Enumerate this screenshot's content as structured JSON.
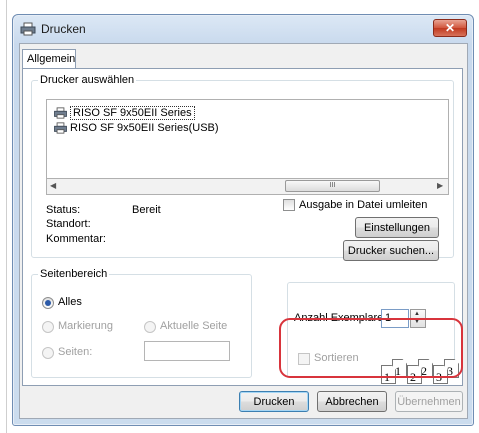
{
  "window": {
    "title": "Drucken",
    "close_glyph": "✕"
  },
  "tabs": [
    {
      "label": "Allgemein"
    }
  ],
  "printer_group": {
    "legend": "Drucker auswählen",
    "printers": [
      {
        "name": "RISO SF 9x50EII Series",
        "selected": true
      },
      {
        "name": "RISO SF 9x50EII Series(USB)",
        "selected": false
      }
    ],
    "scroll_thumb_glyph": "III",
    "status_label": "Status:",
    "status_value": "Bereit",
    "location_label": "Standort:",
    "comment_label": "Kommentar:",
    "print_to_file_label": "Ausgabe in Datei umleiten",
    "settings_button": "Einstellungen",
    "find_printer_button": "Drucker suchen..."
  },
  "page_range": {
    "legend": "Seitenbereich",
    "options": [
      {
        "label": "Alles",
        "checked": true,
        "disabled": false
      },
      {
        "label": "Markierung",
        "checked": false,
        "disabled": true
      },
      {
        "label": "Aktuelle Seite",
        "checked": false,
        "disabled": true
      },
      {
        "label": "Seiten:",
        "checked": false,
        "disabled": true
      }
    ],
    "pages_value": ""
  },
  "copies": {
    "label": "Anzahl Exemplare:",
    "value": "1",
    "collate_label": "Sortieren",
    "collate_checked": false,
    "collate_pages": [
      "1",
      "2",
      "3"
    ]
  },
  "footer": {
    "print_button": "Drucken",
    "cancel_button": "Abbrechen",
    "apply_button": "Übernehmen"
  },
  "colors": {
    "highlight": "#d8343c",
    "titlebar": "#c8d9ed",
    "close_button": "#c0391f"
  },
  "icons": [
    "printer-icon",
    "close-icon",
    "scroll-left-icon",
    "scroll-right-icon",
    "spin-up-icon",
    "spin-down-icon"
  ]
}
